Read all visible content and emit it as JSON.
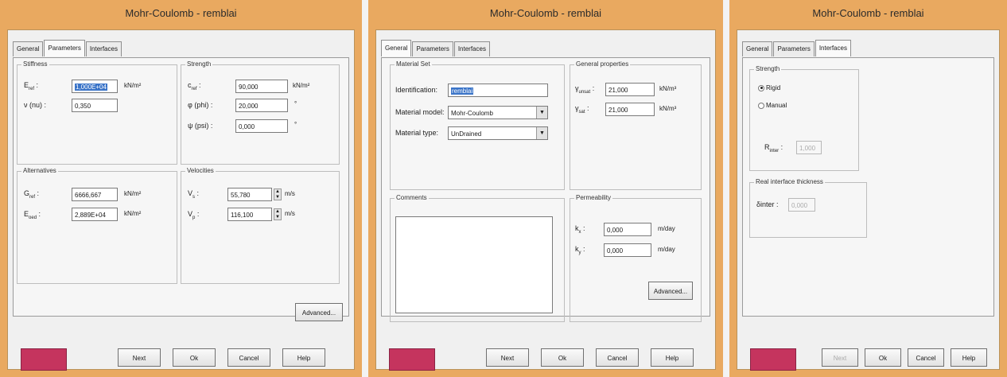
{
  "windows": [
    {
      "title": "Mohr-Coulomb - remblai",
      "tabs": [
        "General",
        "Parameters",
        "Interfaces"
      ],
      "stiffness": {
        "title": "Stiffness",
        "e_ref_label": "E",
        "e_ref_sub": "ref",
        "e_ref_value": "1,000E+04",
        "e_ref_unit": "kN/m²",
        "nu_label": "ν (nu) :",
        "nu_value": "0,350"
      },
      "strength": {
        "title": "Strength",
        "c_ref_label": "c",
        "c_ref_sub": "ref",
        "c_ref_value": "90,000",
        "c_ref_unit": "kN/m²",
        "phi_label": "φ (phi) :",
        "phi_value": "20,000",
        "phi_unit": "°",
        "psi_label": "ψ (psi) :",
        "psi_value": "0,000",
        "psi_unit": "°"
      },
      "alternatives": {
        "title": "Alternatives",
        "g_ref_label": "G",
        "g_ref_sub": "ref",
        "g_ref_value": "6666,667",
        "g_ref_unit": "kN/m²",
        "e_oed_label": "E",
        "e_oed_sub": "oed",
        "e_oed_value": "2,889E+04",
        "e_oed_unit": "kN/m²"
      },
      "velocities": {
        "title": "Velocities",
        "vs_label": "V",
        "vs_sub": "s",
        "vs_value": "55,780",
        "vs_unit": "m/s",
        "vp_label": "V",
        "vp_sub": "p",
        "vp_value": "116,100",
        "vp_unit": "m/s"
      },
      "advanced_label": "Advanced...",
      "buttons": {
        "next": "Next",
        "ok": "Ok",
        "cancel": "Cancel",
        "help": "Help"
      },
      "swatch_color": "#c5345e"
    },
    {
      "title": "Mohr-Coulomb - remblai",
      "tabs": [
        "General",
        "Parameters",
        "Interfaces"
      ],
      "material_set": {
        "title": "Material Set",
        "identification_label": "Identification:",
        "identification_value": "remblai",
        "model_label": "Material model:",
        "model_value": "Mohr-Coulomb",
        "type_label": "Material type:",
        "type_value": "UnDrained"
      },
      "general_properties": {
        "title": "General properties",
        "gamma_unsat_label": "γ",
        "gamma_unsat_sub": "unsat",
        "gamma_unsat_value": "21,000",
        "gamma_unsat_unit": "kN/m³",
        "gamma_sat_label": "γ",
        "gamma_sat_sub": "sat",
        "gamma_sat_value": "21,000",
        "gamma_sat_unit": "kN/m³"
      },
      "comments_title": "Comments",
      "permeability": {
        "title": "Permeability",
        "kx_label": "k",
        "kx_sub": "x",
        "kx_value": "0,000",
        "kx_unit": "m/day",
        "ky_label": "k",
        "ky_sub": "y",
        "ky_value": "0,000",
        "ky_unit": "m/day"
      },
      "advanced_label": "Advanced...",
      "buttons": {
        "next": "Next",
        "ok": "Ok",
        "cancel": "Cancel",
        "help": "Help"
      },
      "swatch_color": "#c5345e"
    },
    {
      "title": "Mohr-Coulomb - remblai",
      "tabs": [
        "General",
        "Parameters",
        "Interfaces"
      ],
      "strength": {
        "title": "Strength",
        "rigid_label": "Rigid",
        "manual_label": "Manual",
        "rinter_label": "R",
        "rinter_sub": "inter",
        "rinter_value": "1,000"
      },
      "thickness": {
        "title": "Real interface thickness",
        "dinter_label": "δinter :",
        "dinter_value": "0,000"
      },
      "buttons": {
        "next": "Next",
        "ok": "Ok",
        "cancel": "Cancel",
        "help": "Help"
      },
      "swatch_color": "#c5345e"
    }
  ]
}
